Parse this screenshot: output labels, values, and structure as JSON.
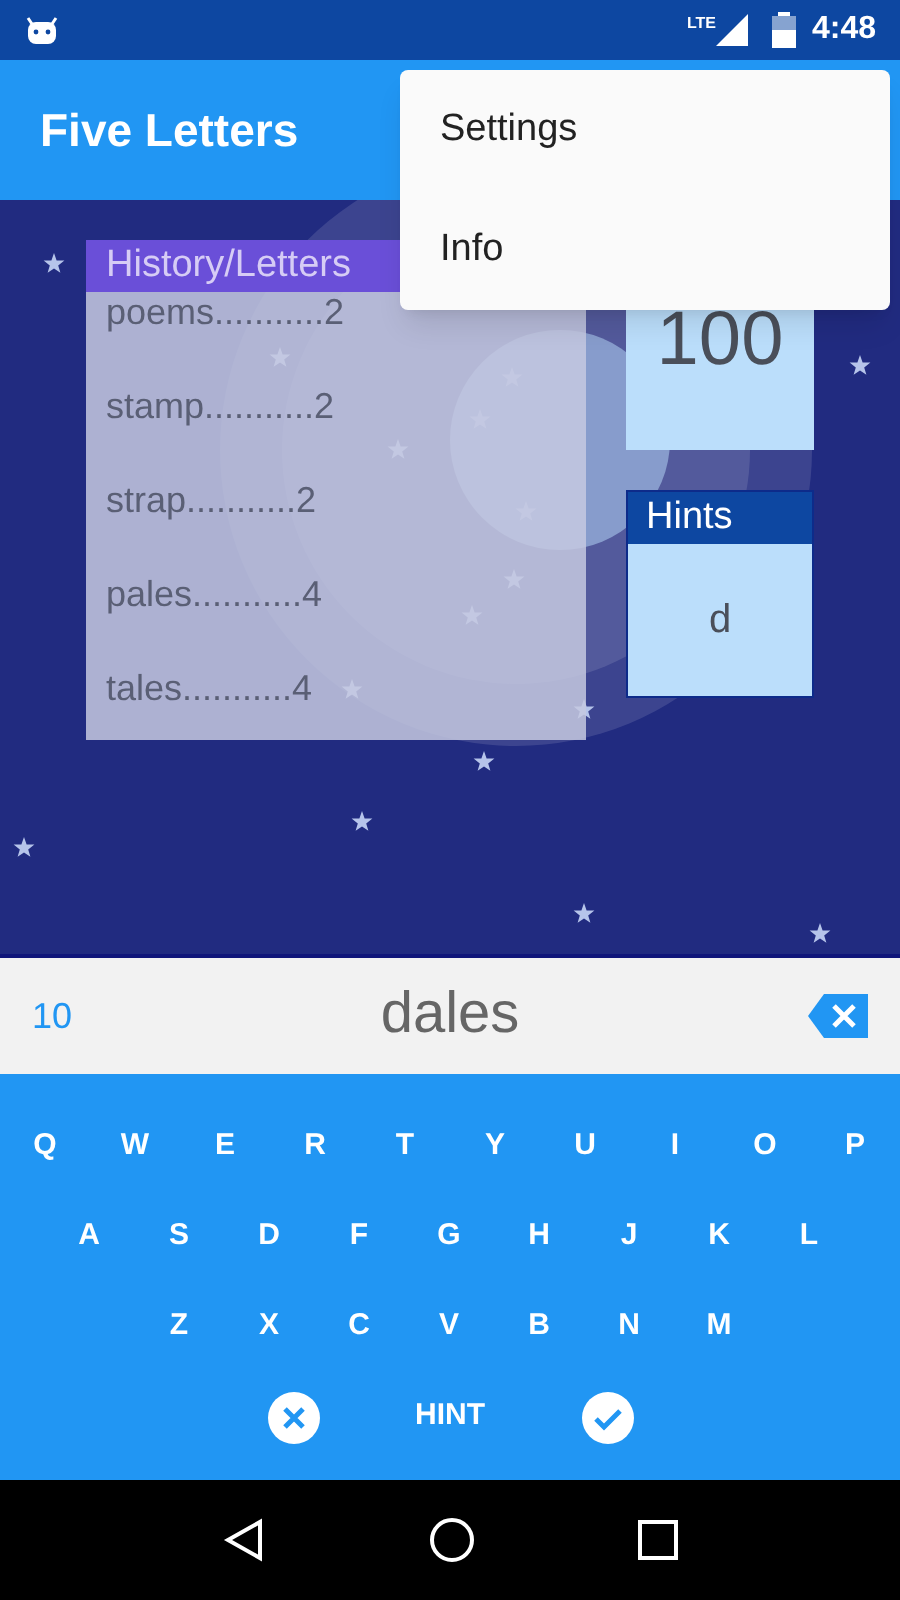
{
  "status_bar": {
    "network": "LTE",
    "time": "4:48"
  },
  "app_bar": {
    "title": "Five Letters"
  },
  "menu": {
    "items": [
      "Settings",
      "Info"
    ]
  },
  "history": {
    "title": "History/Letters",
    "entries": [
      "poems...........2",
      "stamp...........2",
      "strap...........2",
      "pales...........4",
      "tales...........4"
    ]
  },
  "score": {
    "value": "100"
  },
  "hints": {
    "title": "Hints",
    "value": "d"
  },
  "input": {
    "count": "10",
    "word": "dales"
  },
  "keyboard": {
    "rows": [
      [
        "Q",
        "W",
        "E",
        "R",
        "T",
        "Y",
        "U",
        "I",
        "O",
        "P"
      ],
      [
        "A",
        "S",
        "D",
        "F",
        "G",
        "H",
        "J",
        "K",
        "L"
      ],
      [
        "Z",
        "X",
        "C",
        "V",
        "B",
        "N",
        "M"
      ]
    ],
    "hint": "HINT"
  }
}
